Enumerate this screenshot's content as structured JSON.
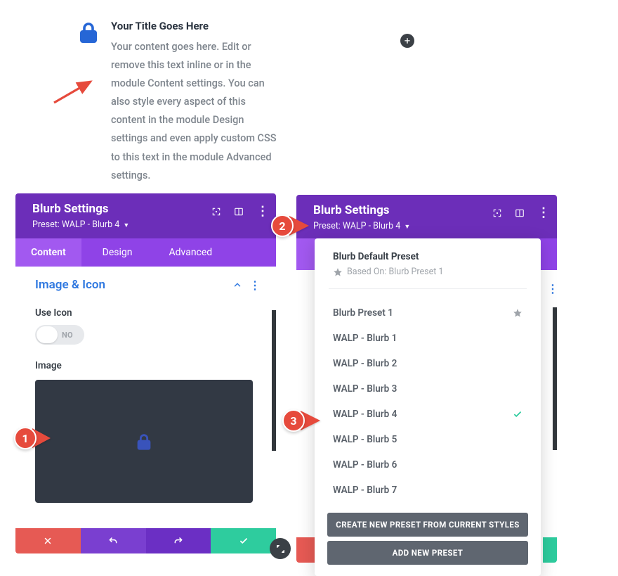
{
  "blurb": {
    "title": "Your Title Goes Here",
    "body": "Your content goes here. Edit or remove this text inline or in the module Content settings. You can also style every aspect of this content in the module Design settings and even apply custom CSS to this text in the module Advanced settings."
  },
  "panel": {
    "title": "Blurb Settings",
    "preset_label": "Preset: WALP - Blurb 4",
    "tabs": {
      "content": "Content",
      "design": "Design",
      "advanced": "Advanced"
    },
    "section": {
      "title": "Image & Icon",
      "use_icon_label": "Use Icon",
      "toggle_text": "NO",
      "image_label": "Image"
    }
  },
  "dropdown": {
    "default_title": "Blurb Default Preset",
    "based_on": "Based On: Blurb Preset 1",
    "items": [
      {
        "label": "Blurb Preset 1",
        "star": true
      },
      {
        "label": "WALP - Blurb 1"
      },
      {
        "label": "WALP - Blurb 2"
      },
      {
        "label": "WALP - Blurb 3"
      },
      {
        "label": "WALP - Blurb 4",
        "checked": true
      },
      {
        "label": "WALP - Blurb 5"
      },
      {
        "label": "WALP - Blurb 6"
      },
      {
        "label": "WALP - Blurb 7"
      }
    ],
    "btn_create": "CREATE NEW PRESET FROM CURRENT STYLES",
    "btn_add": "ADD NEW PRESET"
  },
  "callouts": {
    "c1": "1",
    "c2": "2",
    "c3": "3"
  }
}
